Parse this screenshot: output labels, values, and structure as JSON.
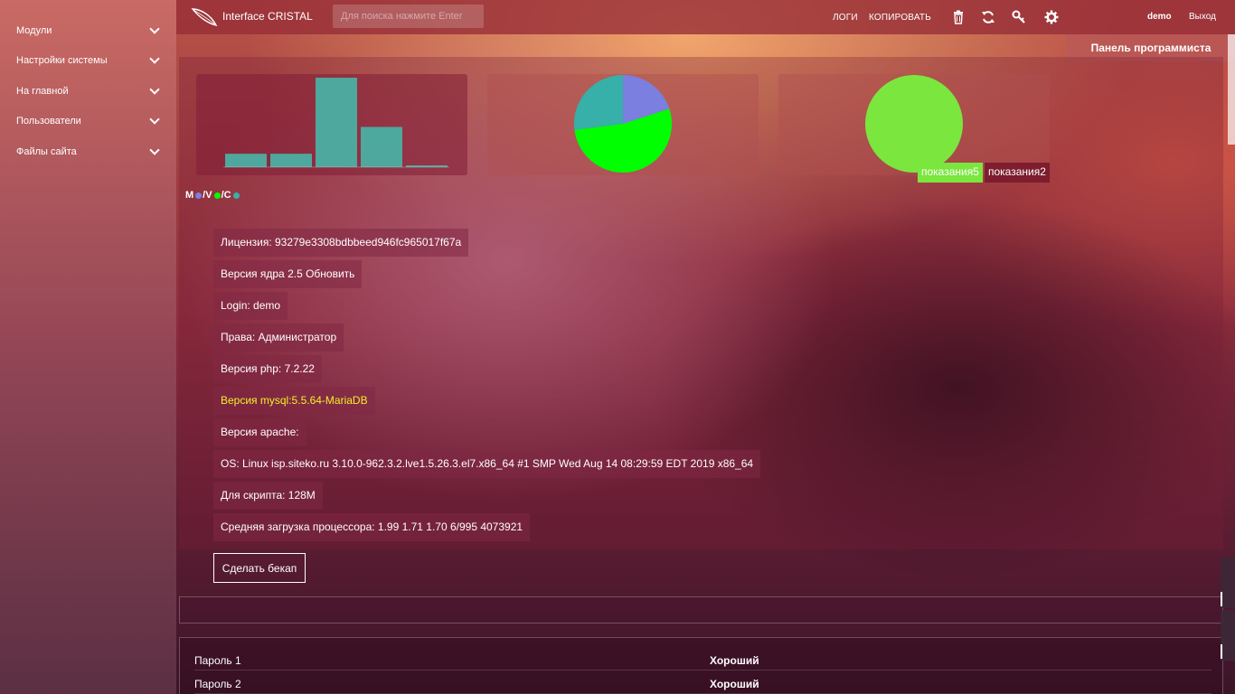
{
  "sidebar": {
    "items": [
      {
        "label": "Модули"
      },
      {
        "label": "Настройки системы"
      },
      {
        "label": "На главной"
      },
      {
        "label": "Пользователи"
      },
      {
        "label": "Файлы сайта"
      }
    ]
  },
  "topbar": {
    "title": "Interface CRISTAL",
    "search_placeholder": "Для поиска нажмите Enter",
    "logs": "ЛОГИ",
    "copy": "КОПИРОВАТЬ",
    "icons": [
      "trash-icon",
      "refresh-icon",
      "key-icon",
      "gear-icon"
    ],
    "user": "demo",
    "exit": "Выход"
  },
  "programmer_panel": "Панель программиста",
  "charts": {
    "legend": {
      "m": "M",
      "v": "/V",
      "c": "/C"
    },
    "legend_colors": {
      "m": "#7a7fe0",
      "v": "#00ff00",
      "c": "#36b0a8"
    },
    "circle_tags": [
      "показания5",
      "показания2"
    ],
    "circle_tag_colors": [
      "#7be63e",
      "#7d1d2d"
    ]
  },
  "chart_data": [
    {
      "type": "bar",
      "categories": [
        "",
        "",
        "",
        "",
        ""
      ],
      "values": [
        15,
        15,
        100,
        45,
        2
      ],
      "color": "#4ea89d"
    },
    {
      "type": "pie",
      "labels": [
        "M",
        "V",
        "C"
      ],
      "values": [
        20,
        53,
        27
      ],
      "colors": [
        "#7a7fe0",
        "#00ff00",
        "#36b0a8"
      ]
    },
    {
      "type": "pie",
      "labels": [
        "показания5",
        "показания2"
      ],
      "values": [
        100,
        0
      ],
      "colors": [
        "#7be63e",
        "#7d1d2d"
      ]
    }
  ],
  "info": {
    "license": "Лицензия: 93279e3308bdbbeed946fc965017f67a",
    "core": "Версия ядра 2.5 Обновить",
    "login": "Login: demo",
    "rights": "Права: Администратор",
    "php": "Версия php: 7.2.22",
    "mysql": "Версия mysql:5.5.64-MariaDB",
    "apache": "Версия apache:",
    "os": "OS: Linux isp.siteko.ru 3.10.0-962.3.2.lve1.5.26.3.el7.x86_64 #1 SMP Wed Aug 14 08:29:59 EDT 2019 x86_64",
    "script": "Для скрипта: 128M",
    "load": "Средняя загрузка процессора: 1.99 1.71 1.70 6/995 4073921"
  },
  "backup_button": "Сделать бекап",
  "passwords": [
    {
      "name": "Пароль 1",
      "status": "Хороший"
    },
    {
      "name": "Пароль 2",
      "status": "Хороший"
    }
  ]
}
